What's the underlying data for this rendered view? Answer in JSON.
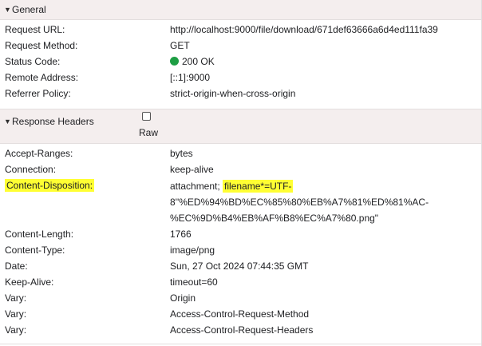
{
  "general": {
    "title": "General",
    "rows": [
      {
        "name": "Request URL:",
        "value": "http://localhost:9000/file/download/671def63666a6d4ed111fa39"
      },
      {
        "name": "Request Method:",
        "value": "GET"
      },
      {
        "name": "Status Code:",
        "value": "200 OK"
      },
      {
        "name": "Remote Address:",
        "value": "[::1]:9000"
      },
      {
        "name": "Referrer Policy:",
        "value": "strict-origin-when-cross-origin"
      }
    ]
  },
  "response": {
    "title": "Response Headers",
    "raw_label": "Raw",
    "rows": {
      "accept_ranges": {
        "name": "Accept-Ranges:",
        "value": "bytes"
      },
      "connection": {
        "name": "Connection:",
        "value": "keep-alive"
      },
      "content_disposition": {
        "name": "Content-Disposition:",
        "value_prefix": "attachment; ",
        "value_highlight": "filename*=UTF-",
        "value_line2": "8''%ED%94%BD%EC%85%80%EB%A7%81%ED%81%AC-",
        "value_line3": "%EC%9D%B4%EB%AF%B8%EC%A7%80.png\""
      },
      "content_length": {
        "name": "Content-Length:",
        "value": "1766"
      },
      "content_type": {
        "name": "Content-Type:",
        "value": "image/png"
      },
      "date": {
        "name": "Date:",
        "value": "Sun, 27 Oct 2024 07:44:35 GMT"
      },
      "keep_alive": {
        "name": "Keep-Alive:",
        "value": "timeout=60"
      },
      "vary1": {
        "name": "Vary:",
        "value": "Origin"
      },
      "vary2": {
        "name": "Vary:",
        "value": "Access-Control-Request-Method"
      },
      "vary3": {
        "name": "Vary:",
        "value": "Access-Control-Request-Headers"
      }
    }
  },
  "colors": {
    "section_bg": "#f4eeee",
    "status_ok": "#1e9e44",
    "highlight": "#ffff33"
  },
  "icons": {
    "expand": "triangle-down-icon",
    "status": "status-dot-icon"
  }
}
